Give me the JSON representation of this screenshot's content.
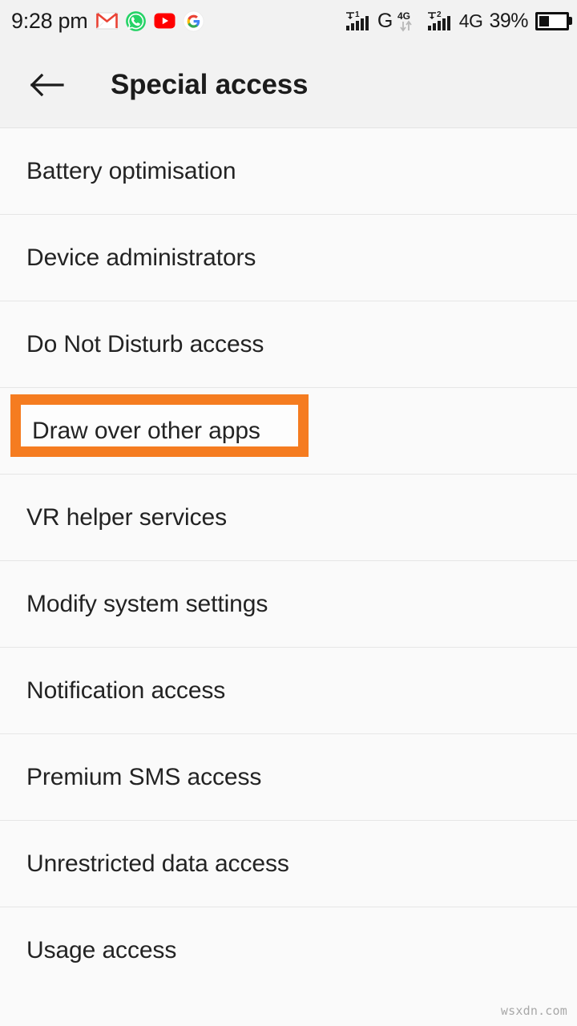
{
  "status_bar": {
    "clock": "9:28 pm",
    "app_icons": [
      {
        "name": "gmail-icon",
        "label": "Gmail"
      },
      {
        "name": "whatsapp-icon",
        "label": "WhatsApp"
      },
      {
        "name": "youtube-icon",
        "label": "YouTube"
      },
      {
        "name": "google-icon",
        "label": "Google"
      }
    ],
    "sim1_signal_badge": "1",
    "sim1_network": "G",
    "data_badge": "4G",
    "sim2_signal_badge": "2",
    "sim2_network": "4G",
    "battery_percent": "39%",
    "battery_level": 39
  },
  "appbar": {
    "back_icon": "arrow-left-icon",
    "title": "Special access"
  },
  "list": {
    "items": [
      {
        "label": "Battery optimisation",
        "highlighted": false
      },
      {
        "label": "Device administrators",
        "highlighted": false
      },
      {
        "label": "Do Not Disturb access",
        "highlighted": false
      },
      {
        "label": "Draw over other apps",
        "highlighted": true
      },
      {
        "label": "VR helper services",
        "highlighted": false
      },
      {
        "label": "Modify system settings",
        "highlighted": false
      },
      {
        "label": "Notification access",
        "highlighted": false
      },
      {
        "label": "Premium SMS access",
        "highlighted": false
      },
      {
        "label": "Unrestricted data access",
        "highlighted": false
      },
      {
        "label": "Usage access",
        "highlighted": false
      }
    ]
  },
  "annotation": {
    "highlight_color": "#f57c20",
    "target_label": "Draw over other apps"
  },
  "watermark": {
    "text": "wsxdn.com"
  },
  "colors": {
    "page_background": "#fafafa",
    "appbar_background": "#f2f2f2",
    "divider": "#e6e6e6",
    "text_primary": "#232323",
    "accent_orange": "#f57c20"
  }
}
